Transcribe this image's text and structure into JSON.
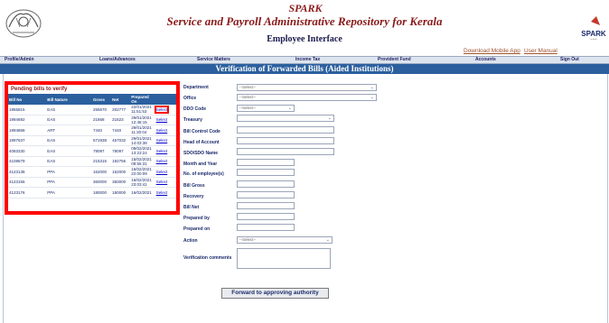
{
  "header": {
    "logo_text": "SPARK",
    "title": "Service and Payroll Administrative Repository for Kerala",
    "subtitle": "Employee Interface",
    "download_link": "Download Mobile App",
    "manual_link": "User Manual",
    "right_logo_text": "SPARK",
    "right_logo_sub": "Service and Payroll Administrative Repository for Kerala"
  },
  "menu": {
    "items": [
      "Profile/Admin",
      "Loans/Advances",
      "Service Matters",
      "Income Tax",
      "Provident Fund",
      "Accounts",
      "Sign Out"
    ]
  },
  "page_title": "Verification of Forwarded Bills (Aided Institutions)",
  "pending": {
    "heading": "Pending bills to verify",
    "columns": [
      "Bill No",
      "Bill Nature",
      "Gross",
      "Net",
      "Prepared On",
      ""
    ],
    "rows": [
      {
        "bill_no": "1955815",
        "nature": "EAS",
        "gross": "255670",
        "net": "202777",
        "prepared": "22/01/2021 11:51:53",
        "action": "Select"
      },
      {
        "bill_no": "1994692",
        "nature": "EAS",
        "gross": "21668",
        "net": "21623",
        "prepared": "29/01/2021 12:48:15",
        "action": "Select"
      },
      {
        "bill_no": "1994868",
        "nature": "ART",
        "gross": "7440",
        "net": "7440",
        "prepared": "29/01/2021 11:30:04",
        "action": "Select"
      },
      {
        "bill_no": "1997637",
        "nature": "EAS",
        "gross": "571938",
        "net": "457032",
        "prepared": "29/01/2021 14:03:38",
        "action": "Select"
      },
      {
        "bill_no": "4083330",
        "nature": "EAS",
        "gross": "78097",
        "net": "78097",
        "prepared": "09/02/2021 13:23:24",
        "action": "Select"
      },
      {
        "bill_no": "4108679",
        "nature": "EAS",
        "gross": "215316",
        "net": "192756",
        "prepared": "15/02/2021 09:56:31",
        "action": "Select"
      },
      {
        "bill_no": "4123138",
        "nature": "PPA",
        "gross": "162000",
        "net": "162000",
        "prepared": "16/02/2021 22:00:09",
        "action": "Select"
      },
      {
        "bill_no": "4123156",
        "nature": "PPA",
        "gross": "360000",
        "net": "360000",
        "prepared": "16/02/2021 23:03:41",
        "action": "Select"
      },
      {
        "bill_no": "4123176",
        "nature": "PPA",
        "gross": "180000",
        "net": "180000",
        "prepared": "16/02/2021",
        "action": "Select"
      }
    ]
  },
  "form": {
    "department_label": "Department",
    "department_value": "--Select--",
    "office_label": "Office",
    "office_value": "--Select--",
    "ddo_code_label": "DDO Code",
    "ddo_code_value": "--Select--",
    "treasury_label": "Treasury",
    "treasury_value": "",
    "bill_control_label": "Bill Control Code",
    "head_account_label": "Head of Account",
    "ddo_name_label": "SDO/SDO Name",
    "month_year_label": "Month and Year",
    "num_employees_label": "No. of employee(s)",
    "bill_gross_label": "Bill Gross",
    "recovery_label": "Recovery",
    "bill_net_label": "Bill Net",
    "prepared_by_label": "Prepared by",
    "prepared_on_label": "Prepared on",
    "action_label": "Action",
    "action_value": "--Select--",
    "comments_label": "Verification comments",
    "forward_button": "Forward to approving authority"
  },
  "colors": {
    "title_bar": "#2b5f9e",
    "highlight": "#ff0000",
    "brand": "#8b1a1a"
  }
}
